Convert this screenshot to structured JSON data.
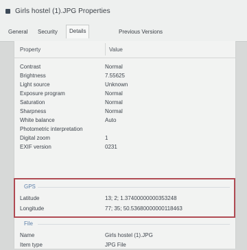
{
  "window": {
    "title": "Girls hostel (1).JPG Properties"
  },
  "tabs": [
    {
      "label": "General"
    },
    {
      "label": "Security"
    },
    {
      "label": "Details"
    },
    {
      "label": "Previous Versions"
    }
  ],
  "columns": {
    "property": "Property",
    "value": "Value"
  },
  "rows": [
    {
      "property": "Contrast",
      "value": "Normal"
    },
    {
      "property": "Brightness",
      "value": "7.55625"
    },
    {
      "property": "Light source",
      "value": "Unknown"
    },
    {
      "property": "Exposure program",
      "value": "Normal"
    },
    {
      "property": "Saturation",
      "value": "Normal"
    },
    {
      "property": "Sharpness",
      "value": "Normal"
    },
    {
      "property": "White balance",
      "value": "Auto"
    },
    {
      "property": "Photometric interpretation",
      "value": ""
    },
    {
      "property": "Digital zoom",
      "value": "1"
    },
    {
      "property": "EXIF version",
      "value": "0231"
    }
  ],
  "gps": {
    "group_label": "GPS",
    "rows": [
      {
        "property": "Latitude",
        "value": "13; 2; 1.37400000000353248"
      },
      {
        "property": "Longitude",
        "value": "77; 35; 50.53680000000118463"
      }
    ]
  },
  "file": {
    "group_label": "File",
    "rows": [
      {
        "property": "Name",
        "value": "Girls hostel (1).JPG"
      },
      {
        "property": "Item type",
        "value": "JPG File"
      }
    ]
  },
  "colors": {
    "highlight_border": "#b04a52",
    "group_label": "#5b7fa8"
  }
}
